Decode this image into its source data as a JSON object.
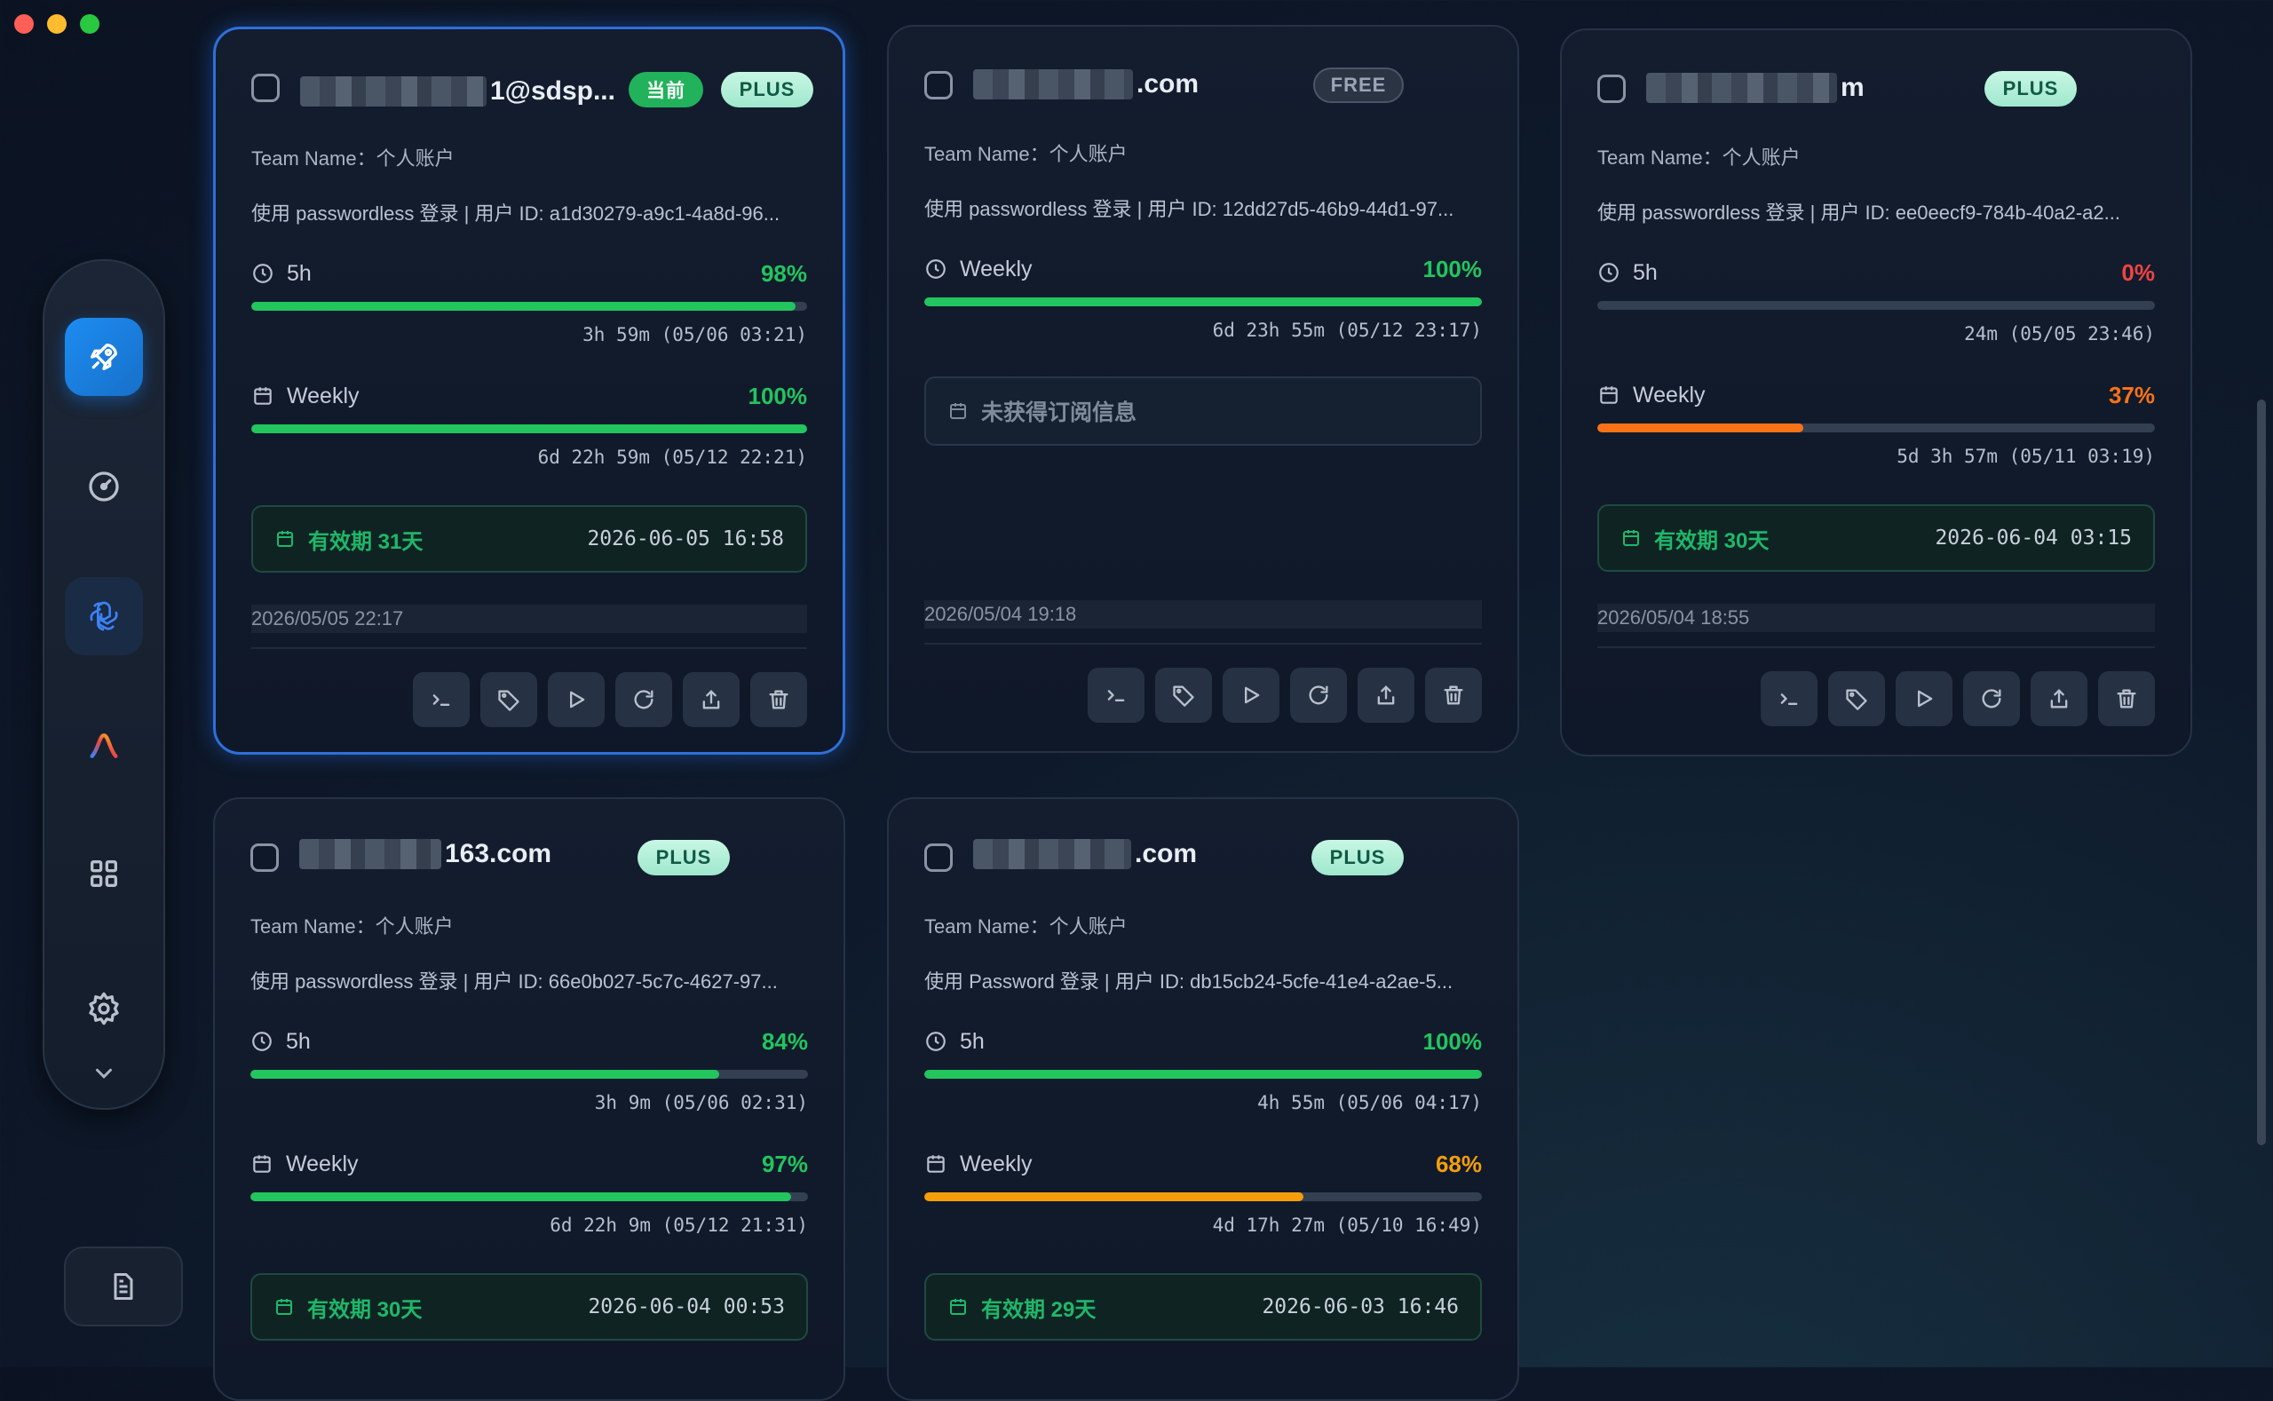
{
  "window": {
    "traffic_colors": [
      "#ff5f57",
      "#febc2e",
      "#28c840"
    ]
  },
  "sidebar": {
    "items": [
      {
        "name": "launch",
        "icon": "rocket-icon",
        "state": "active"
      },
      {
        "name": "usage",
        "icon": "gauge-icon",
        "state": "normal"
      },
      {
        "name": "openai",
        "icon": "openai-icon",
        "state": "selected"
      },
      {
        "name": "antigravity",
        "icon": "antigravity-icon",
        "state": "normal"
      },
      {
        "name": "apps",
        "icon": "grid-icon",
        "state": "normal"
      },
      {
        "name": "settings",
        "icon": "gear-icon",
        "state": "normal"
      }
    ],
    "expand_icon": "chevron-down-icon",
    "doc_icon": "document-icon"
  },
  "accounts": [
    {
      "email_visible": "1@sdsp...",
      "current_badge": "当前",
      "plan": "PLUS",
      "team": "Team Name：个人账户",
      "login": "使用 passwordless 登录 | 用户 ID: a1d30279-a9c1-4a8d-96...",
      "limits": [
        {
          "label": "5h",
          "icon": "clock-icon",
          "percent": "98%",
          "value": 98,
          "color": "#22c55e",
          "reset": "3h 59m (05/06 03:21)"
        },
        {
          "label": "Weekly",
          "icon": "calendar-icon",
          "percent": "100%",
          "value": 100,
          "color": "#22c55e",
          "reset": "6d 22h 59m (05/12 22:21)"
        }
      ],
      "expiry": {
        "days": "有效期 31天",
        "date": "2026-06-05 16:58"
      },
      "created": "2026/05/05 22:17"
    },
    {
      "email_visible": ".com",
      "plan": "FREE",
      "team": "Team Name：个人账户",
      "login": "使用 passwordless 登录 | 用户 ID: 12dd27d5-46b9-44d1-97...",
      "limits": [
        {
          "label": "Weekly",
          "icon": "clock-icon",
          "percent": "100%",
          "value": 100,
          "color": "#22c55e",
          "reset": "6d 23h 55m (05/12 23:17)"
        }
      ],
      "no_subscription": "未获得订阅信息",
      "created": "2026/05/04 19:18"
    },
    {
      "email_visible": "m",
      "plan": "PLUS",
      "team": "Team Name：个人账户",
      "login": "使用 passwordless 登录 | 用户 ID: ee0eecf9-784b-40a2-a2...",
      "limits": [
        {
          "label": "5h",
          "icon": "clock-icon",
          "percent": "0%",
          "value": 0,
          "color": "#ef4444",
          "reset": "24m (05/05 23:46)"
        },
        {
          "label": "Weekly",
          "icon": "calendar-icon",
          "percent": "37%",
          "value": 37,
          "color": "#f97316",
          "reset": "5d 3h 57m (05/11 03:19)"
        }
      ],
      "expiry": {
        "days": "有效期 30天",
        "date": "2026-06-04 03:15"
      },
      "created": "2026/05/04 18:55"
    },
    {
      "email_visible": "163.com",
      "plan": "PLUS",
      "team": "Team Name：个人账户",
      "login": "使用 passwordless 登录 | 用户 ID: 66e0b027-5c7c-4627-97...",
      "limits": [
        {
          "label": "5h",
          "icon": "clock-icon",
          "percent": "84%",
          "value": 84,
          "color": "#22c55e",
          "reset": "3h 9m (05/06 02:31)"
        },
        {
          "label": "Weekly",
          "icon": "calendar-icon",
          "percent": "97%",
          "value": 97,
          "color": "#22c55e",
          "reset": "6d 22h 9m (05/12 21:31)"
        }
      ],
      "expiry": {
        "days": "有效期 30天",
        "date": "2026-06-04 00:53"
      }
    },
    {
      "email_visible": ".com",
      "plan": "PLUS",
      "team": "Team Name：个人账户",
      "login": "使用 Password 登录 | 用户 ID: db15cb24-5cfe-41e4-a2ae-5...",
      "limits": [
        {
          "label": "5h",
          "icon": "clock-icon",
          "percent": "100%",
          "value": 100,
          "color": "#22c55e",
          "reset": "4h 55m (05/06 04:17)"
        },
        {
          "label": "Weekly",
          "icon": "calendar-icon",
          "percent": "68%",
          "value": 68,
          "color": "#f59e0b",
          "reset": "4d 17h 27m (05/10 16:49)"
        }
      ],
      "expiry": {
        "days": "有效期 29天",
        "date": "2026-06-03 16:46"
      }
    }
  ],
  "card_actions": [
    "terminal-icon",
    "tag-icon",
    "play-icon",
    "refresh-icon",
    "export-icon",
    "trash-icon"
  ]
}
